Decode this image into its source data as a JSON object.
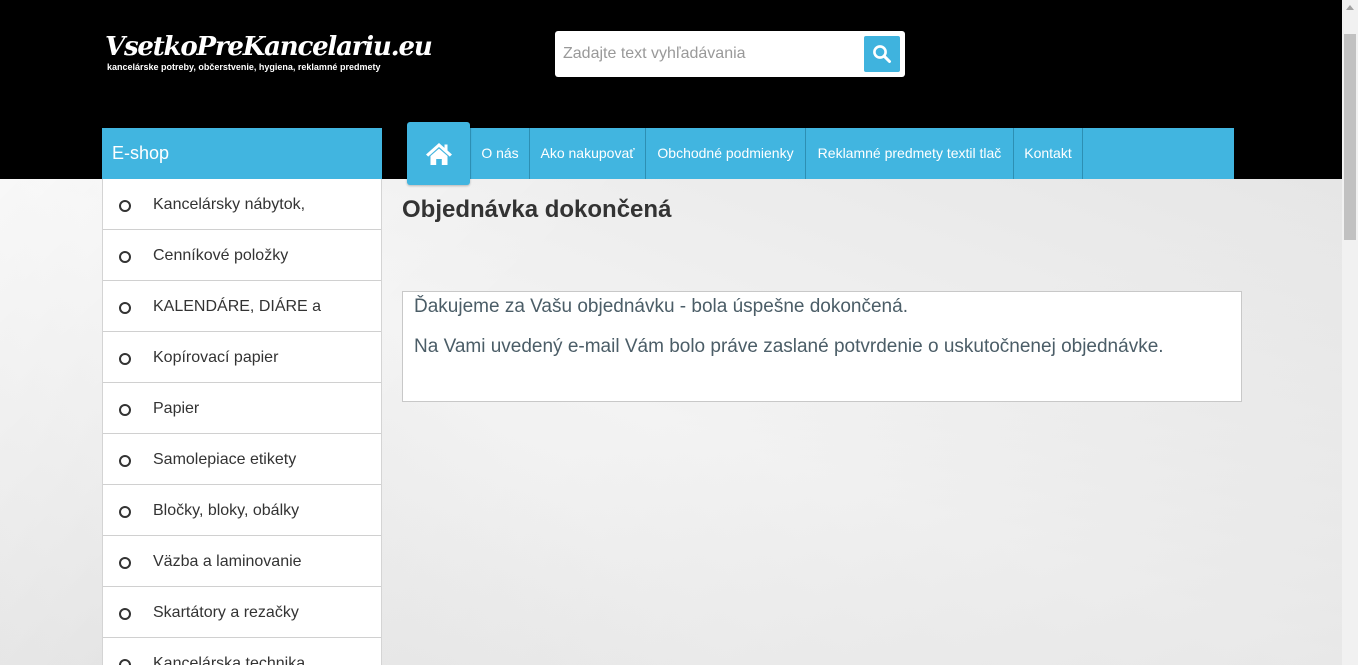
{
  "header": {
    "logo_title": "VsetkoPreKancelariu.eu",
    "logo_subtitle": "kancelárske potreby, občerstvenie, hygiena, reklamné predmety",
    "search_placeholder": "Zadajte text vyhľadávania",
    "search_icon": "search-icon"
  },
  "sidebar": {
    "title": "E-shop",
    "items": [
      {
        "label": "Kancelársky nábytok,"
      },
      {
        "label": "Cenníkové položky"
      },
      {
        "label": "KALENDÁRE, DIÁRE a"
      },
      {
        "label": "Kopírovací papier"
      },
      {
        "label": "Papier"
      },
      {
        "label": "Samolepiace etikety"
      },
      {
        "label": "Bločky, bloky, obálky"
      },
      {
        "label": "Väzba a laminovanie"
      },
      {
        "label": "Skartátory a rezačky"
      },
      {
        "label": "Kancelárska technika"
      }
    ]
  },
  "nav": {
    "home_icon": "home-icon",
    "items": [
      {
        "label": "O nás"
      },
      {
        "label": "Ako nakupovať"
      },
      {
        "label": "Obchodné podmienky"
      },
      {
        "label": "Reklamné predmety textil tlač"
      },
      {
        "label": "Kontakt"
      }
    ]
  },
  "main": {
    "title": "Objednávka dokončená",
    "message_line1": "Ďakujeme za Vašu objednávku - bola úspešne dokončená.",
    "message_line2": "Na Vami uvedený e-mail Vám bolo práve zaslané potvrdenie o uskutočnenej objednávke."
  },
  "colors": {
    "accent": "#41b5e0",
    "header_bg": "#000000",
    "text": "#333333",
    "message_text": "#4b5d67"
  }
}
